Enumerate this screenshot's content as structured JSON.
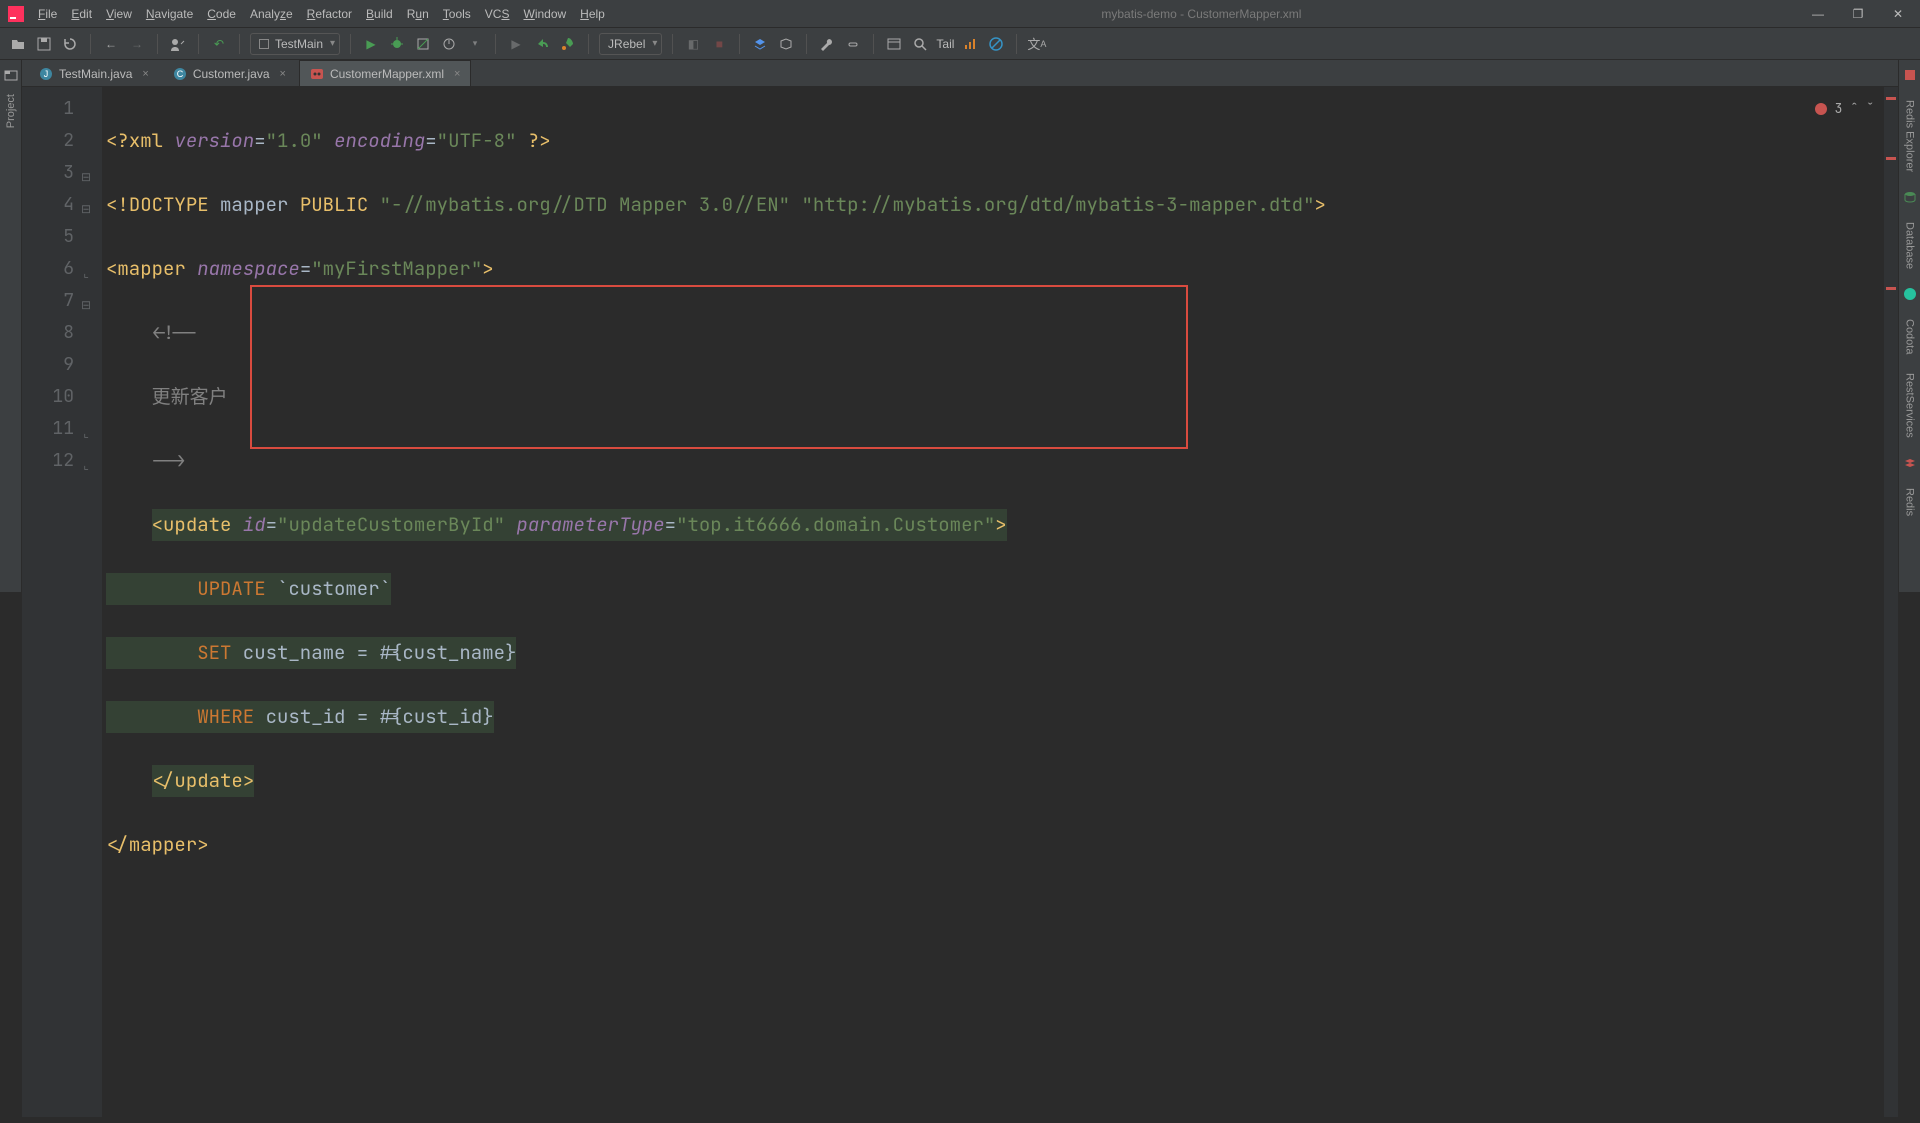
{
  "window": {
    "title": "mybatis-demo - CustomerMapper.xml",
    "menus": [
      "File",
      "Edit",
      "View",
      "Navigate",
      "Code",
      "Analyze",
      "Refactor",
      "Build",
      "Run",
      "Tools",
      "VCS",
      "Window",
      "Help"
    ]
  },
  "toolbar": {
    "run_config": "TestMain",
    "jrebel": "JRebel",
    "tail": "Tail"
  },
  "left_stripe": {
    "project": "Project"
  },
  "right_stripe": [
    "Redis Explorer",
    "Database",
    "Codota",
    "RestServices",
    "Redis"
  ],
  "tabs": [
    {
      "label": "TestMain.java",
      "icon": "java",
      "active": false
    },
    {
      "label": "Customer.java",
      "icon": "class",
      "active": false
    },
    {
      "label": "CustomerMapper.xml",
      "icon": "xml",
      "active": true
    }
  ],
  "editor": {
    "error_count": "3",
    "gutter_lines": [
      "1",
      "2",
      "3",
      "4",
      "5",
      "6",
      "7",
      "8",
      "9",
      "10",
      "11",
      "12"
    ],
    "code": {
      "l1": {
        "pi_open": "<?",
        "pi_name": "xml",
        "attr1": "version",
        "val1": "\"1.0\"",
        "attr2": "encoding",
        "val2": "\"UTF-8\"",
        "pi_close": "?>"
      },
      "l2": {
        "open": "<!",
        "kw": "DOCTYPE",
        "root": "mapper",
        "pub": "PUBLIC",
        "fpi": "\"-//mybatis.org//DTD Mapper 3.0//EN\"",
        "uri": "\"http://mybatis.org/dtd/mybatis-3-mapper.dtd\"",
        "close": ">"
      },
      "l3": {
        "open": "<",
        "tag": "mapper",
        "a1": "namespace",
        "v1": "\"myFirstMapper\"",
        "close": ">"
      },
      "l4": {
        "text": "<!--"
      },
      "l5": {
        "text": "更新客户"
      },
      "l6": {
        "text": "-->"
      },
      "l7": {
        "open": "<",
        "tag": "update",
        "a1": "id",
        "v1": "\"updateCustomerById\"",
        "a2": "parameterType",
        "v2": "\"top.it6666.domain.Customer\"",
        "close": ">"
      },
      "l8": {
        "kw": "UPDATE",
        "rest": " `customer`"
      },
      "l9": {
        "kw": "SET",
        "rest": " cust_name = #{cust_name}"
      },
      "l10": {
        "kw": "WHERE",
        "rest": " cust_id = #{cust_id}"
      },
      "l11": {
        "open": "</",
        "tag": "update",
        "close": ">"
      },
      "l12": {
        "open": "</",
        "tag": "mapper",
        "close": ">"
      }
    }
  }
}
